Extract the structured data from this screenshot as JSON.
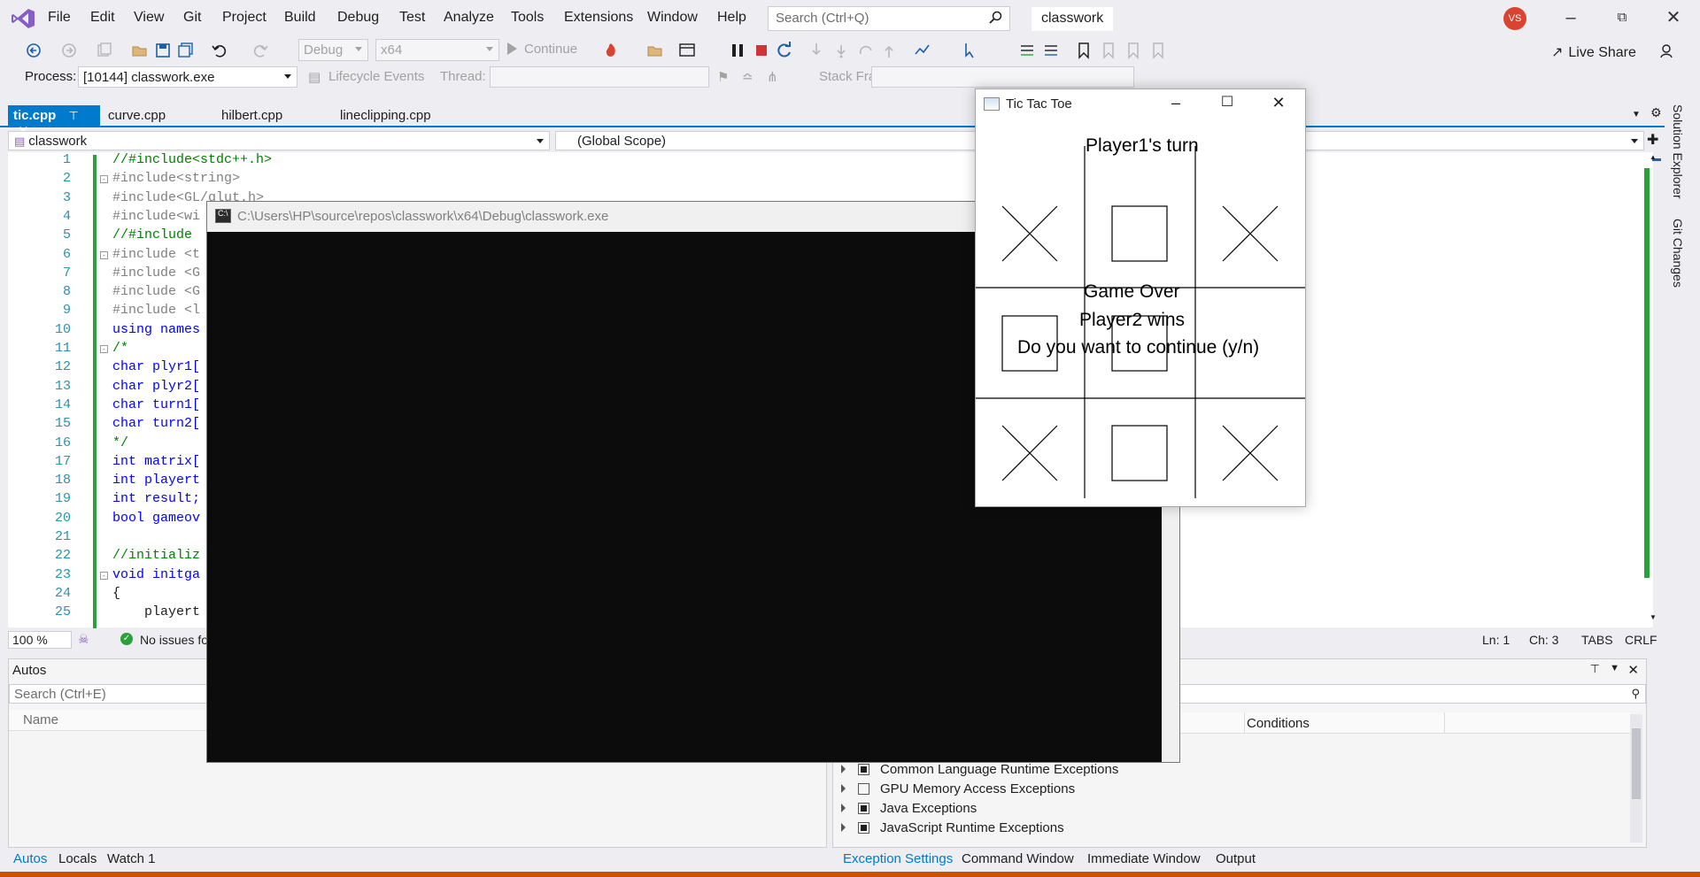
{
  "menu": {
    "items": [
      "File",
      "Edit",
      "View",
      "Git",
      "Project",
      "Build",
      "Debug",
      "Test",
      "Analyze",
      "Tools",
      "Extensions",
      "Window",
      "Help"
    ],
    "search_placeholder": "Search (Ctrl+Q)",
    "solution_name": "classwork",
    "avatar_initials": "VS"
  },
  "toolbar": {
    "config": "Debug",
    "platform": "x64",
    "continue_label": "Continue",
    "live_share_label": "Live Share"
  },
  "debug_location": {
    "process_label": "Process:",
    "process_value": "[10144] classwork.exe",
    "lifecycle_label": "Lifecycle Events",
    "thread_label": "Thread:",
    "stack_frame_label": "Stack Frame:"
  },
  "tabs": [
    "tic.cpp",
    "curve.cpp",
    "hilbert.cpp",
    "lineclipping.cpp"
  ],
  "navbar": {
    "project": "classwork",
    "scope": "(Global Scope)"
  },
  "code_lines": [
    {
      "n": "1",
      "text": "//#include<stdc++.h>"
    },
    {
      "n": "2",
      "text": "#include<string>"
    },
    {
      "n": "3",
      "text": "#include<GL/glut.h>"
    },
    {
      "n": "4",
      "text": "#include<wi"
    },
    {
      "n": "5",
      "text": "//#include"
    },
    {
      "n": "6",
      "text": "#include <t"
    },
    {
      "n": "7",
      "text": "#include <G"
    },
    {
      "n": "8",
      "text": "#include <G"
    },
    {
      "n": "9",
      "text": "#include <l"
    },
    {
      "n": "10",
      "text": "using names"
    },
    {
      "n": "11",
      "text": "/*"
    },
    {
      "n": "12",
      "text": "char plyr1["
    },
    {
      "n": "13",
      "text": "char plyr2["
    },
    {
      "n": "14",
      "text": "char turn1["
    },
    {
      "n": "15",
      "text": "char turn2["
    },
    {
      "n": "16",
      "text": "*/"
    },
    {
      "n": "17",
      "text": "int matrix["
    },
    {
      "n": "18",
      "text": "int playert"
    },
    {
      "n": "19",
      "text": "int result;"
    },
    {
      "n": "20",
      "text": "bool gameov"
    },
    {
      "n": "21",
      "text": ""
    },
    {
      "n": "22",
      "text": "//initializ"
    },
    {
      "n": "23",
      "text": "void initga"
    },
    {
      "n": "24",
      "text": "{"
    },
    {
      "n": "25",
      "text": "    playert"
    }
  ],
  "editor_status": {
    "zoom": "100 %",
    "issues": "No issues fo",
    "ln": "Ln: 1",
    "ch": "Ch: 3",
    "tabs": "TABS",
    "eol": "CRLF"
  },
  "autos_panel": {
    "title": "Autos",
    "search_placeholder": "Search (Ctrl+E)",
    "col_name": "Name"
  },
  "exceptions_panel": {
    "col_conditions": "Conditions",
    "rows": [
      {
        "label": "Common Language Runtime Exceptions",
        "checked": true
      },
      {
        "label": "GPU Memory Access Exceptions",
        "checked": false
      },
      {
        "label": "Java Exceptions",
        "checked": true
      },
      {
        "label": "JavaScript Runtime Exceptions",
        "checked": true
      }
    ]
  },
  "bottom_tabs_left": [
    "Autos",
    "Locals",
    "Watch 1"
  ],
  "bottom_tabs_right": [
    "Exception Settings",
    "Command Window",
    "Immediate Window",
    "Output"
  ],
  "side_rail": [
    "Solution Explorer",
    "Git Changes"
  ],
  "console": {
    "title": "C:\\Users\\HP\\source\\repos\\classwork\\x64\\Debug\\classwork.exe"
  },
  "tictactoe": {
    "title": "Tic Tac Toe",
    "turn_text": "Player1's turn",
    "game_over": "Game Over",
    "winner": "Player2 wins",
    "prompt": "Do you want to continue (y/n)",
    "board": [
      "X",
      "O",
      "X",
      "O",
      "O",
      "",
      "X",
      "O",
      "X"
    ]
  },
  "colors": {
    "accent": "#007acc",
    "change_bar": "#2aa13b",
    "avatar": "#d9432f",
    "console_bg": "#0c0c0c"
  }
}
